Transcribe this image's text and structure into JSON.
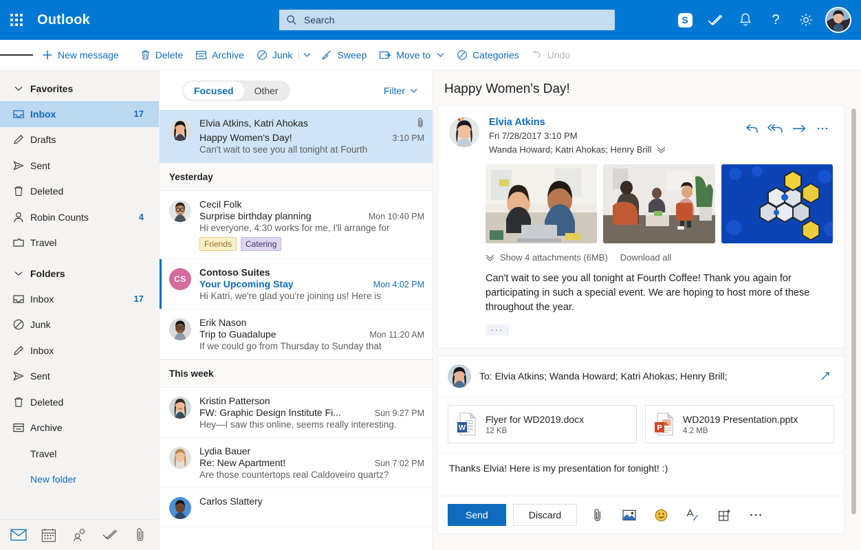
{
  "topbar": {
    "waffle_label": "App launcher",
    "brand": "Outlook",
    "search_placeholder": "Search",
    "search_value": "",
    "icons": [
      {
        "name": "skype-icon",
        "glyph": "S"
      },
      {
        "name": "to-do-icon",
        "glyph": ""
      },
      {
        "name": "notifications-bell-icon",
        "glyph": ""
      },
      {
        "name": "help-icon",
        "glyph": "?"
      },
      {
        "name": "settings-gear-icon",
        "glyph": ""
      }
    ]
  },
  "commandbar": {
    "menu_label": "Menu",
    "new_message": "New message",
    "delete": "Delete",
    "archive": "Archive",
    "junk": "Junk",
    "sweep": "Sweep",
    "move_to": "Move to",
    "categories": "Categories",
    "undo": "Undo"
  },
  "sidebar": {
    "favorites_label": "Favorites",
    "folders_label": "Folders",
    "favorites": [
      {
        "label": "Inbox",
        "count": "17",
        "icon": "inbox-icon",
        "selected": true
      },
      {
        "label": "Drafts",
        "count": "",
        "icon": "pencil-icon",
        "selected": false
      },
      {
        "label": "Sent",
        "count": "",
        "icon": "send-icon",
        "selected": false
      },
      {
        "label": "Deleted",
        "count": "",
        "icon": "trash-icon",
        "selected": false
      },
      {
        "label": "Robin Counts",
        "count": "4",
        "icon": "person-icon",
        "selected": false
      },
      {
        "label": "Travel",
        "count": "",
        "icon": "folder-icon",
        "selected": false
      }
    ],
    "folders": [
      {
        "label": "Inbox",
        "count": "17",
        "icon": "inbox-icon",
        "link": false
      },
      {
        "label": "Junk",
        "count": "",
        "icon": "block-icon",
        "link": false
      },
      {
        "label": "Inbox",
        "count": "",
        "icon": "pencil-icon",
        "link": false
      },
      {
        "label": "Sent",
        "count": "",
        "icon": "send-icon",
        "link": false
      },
      {
        "label": "Deleted",
        "count": "",
        "icon": "trash-icon",
        "link": false
      },
      {
        "label": "Archive",
        "count": "",
        "icon": "archive-icon",
        "link": false
      },
      {
        "label": "Travel",
        "count": "",
        "icon": "none",
        "link": false
      },
      {
        "label": "New folder",
        "count": "",
        "icon": "none",
        "link": true
      }
    ],
    "footer_icons": [
      {
        "name": "mail-icon",
        "active": true
      },
      {
        "name": "calendar-icon",
        "active": false
      },
      {
        "name": "people-icon",
        "active": false
      },
      {
        "name": "to-do-icon",
        "active": false
      },
      {
        "name": "files-icon",
        "active": false
      }
    ]
  },
  "messagelist": {
    "pivot_focused": "Focused",
    "pivot_other": "Other",
    "pivot_selected": "Focused",
    "filter_label": "Filter",
    "groups": [
      {
        "header": "",
        "items": [
          {
            "sender": "Elvia Atkins, Katri Ahokas",
            "subject": "Happy Women's Day!",
            "preview": "Can't wait to see you all tonight at Fourth",
            "time": "3:10 PM",
            "selected": true,
            "unread": false,
            "attachment": true,
            "avatar_type": "photo",
            "avatar_kind": "woman-dark-hair",
            "initials": "",
            "tags": []
          }
        ]
      },
      {
        "header": "Yesterday",
        "items": [
          {
            "sender": "Cecil Folk",
            "subject": "Surprise birthday planning",
            "preview": "Hi everyone, 4:30 works for me, I'll arrange for",
            "time": "Mon 10:40 PM",
            "selected": false,
            "unread": false,
            "attachment": false,
            "avatar_type": "photo",
            "avatar_kind": "man-glasses",
            "initials": "",
            "tags": [
              {
                "label": "Friends",
                "bg": "#faf0c8",
                "fg": "#8a6d1f",
                "border": "#e3cd7f"
              },
              {
                "label": "Catering",
                "bg": "#ded6ef",
                "fg": "#443168",
                "border": "#c2b5dd"
              }
            ]
          },
          {
            "sender": "Contoso Suites",
            "subject": "Your Upcoming Stay",
            "preview": "Hi Katri, we're glad you're joining us! Here is",
            "time": "Mon 4:02 PM",
            "selected": false,
            "unread": true,
            "attachment": false,
            "avatar_type": "initials",
            "avatar_kind": "",
            "initials": "CS",
            "tags": []
          },
          {
            "sender": "Erik Nason",
            "subject": "Trip to Guadalupe",
            "preview": "If we could go from Thursday to Sunday that",
            "time": "Mon 11:20 AM",
            "selected": false,
            "unread": false,
            "attachment": false,
            "avatar_type": "photo",
            "avatar_kind": "man-dark",
            "initials": "",
            "tags": []
          }
        ]
      },
      {
        "header": "This week",
        "items": [
          {
            "sender": "Kristin Patterson",
            "subject": "FW: Graphic Design Institute Fi...",
            "preview": "Hey—I saw this online, seems really interesting.",
            "time": "Sun 9:27 PM",
            "selected": false,
            "unread": false,
            "attachment": false,
            "avatar_type": "photo",
            "avatar_kind": "woman-smiling",
            "initials": "",
            "tags": []
          },
          {
            "sender": "Lydia Bauer",
            "subject": "Re: New Apartment!",
            "preview": "Are those countertops real Caldoveiro quartz?",
            "time": "Sun 7:02 PM",
            "selected": false,
            "unread": false,
            "attachment": false,
            "avatar_type": "photo",
            "avatar_kind": "woman-blonde",
            "initials": "",
            "tags": []
          },
          {
            "sender": "Carlos Slattery",
            "subject": "",
            "preview": "",
            "time": "",
            "selected": false,
            "unread": false,
            "attachment": false,
            "avatar_type": "photo",
            "avatar_kind": "man-blue",
            "initials": "",
            "tags": []
          }
        ]
      }
    ]
  },
  "reading": {
    "title": "Happy Women's Day!",
    "message": {
      "sender": "Elvia Atkins",
      "date": "Fri 7/28/2017 3:10 PM",
      "recipients": "Wanda Howard; Katri Ahokas; Henry Brill",
      "actions": [
        {
          "name": "reply-icon"
        },
        {
          "name": "reply-all-icon"
        },
        {
          "name": "forward-icon"
        },
        {
          "name": "more-actions-icon"
        }
      ],
      "thumbnails": [
        {
          "name": "two-women-laptop-thumbnail"
        },
        {
          "name": "office-meeting-thumbnail"
        },
        {
          "name": "blue-hexagon-abstract-thumbnail"
        }
      ],
      "show_attachments": "Show 4 attachments (6MB)",
      "download_all": "Download all",
      "body": "Can't wait to see you all tonight at Fourth Coffee! Thank you again for participating in such a special event. We are hoping to host more of these throughout the year.",
      "expand_dots": "···"
    },
    "compose": {
      "to_line": "To: Elvia Atkins; Wanda Howard; Katri Ahokas; Henry Brill;",
      "expand_label": "Expand",
      "attachments": [
        {
          "name": "Flyer for WD2019.docx",
          "size": "12 KB",
          "kind": "word"
        },
        {
          "name": "WD2019 Presentation.pptx",
          "size": "4.2 MB",
          "kind": "powerpoint"
        }
      ],
      "body": "Thanks Elvia! Here is my presentation for tonight! :)",
      "send_label": "Send",
      "discard_label": "Discard",
      "tools": [
        {
          "name": "attach-file-icon"
        },
        {
          "name": "insert-picture-icon"
        },
        {
          "name": "emoji-icon"
        },
        {
          "name": "signature-icon"
        },
        {
          "name": "insert-table-icon"
        },
        {
          "name": "more-options-icon"
        }
      ]
    }
  },
  "colors": {
    "brand_blue": "#0078d4",
    "link_blue": "#0f6cbd",
    "selected_row": "#cfe4f7",
    "sidebar_bg": "#f4f3f2",
    "reading_bg": "#faf9f8"
  }
}
